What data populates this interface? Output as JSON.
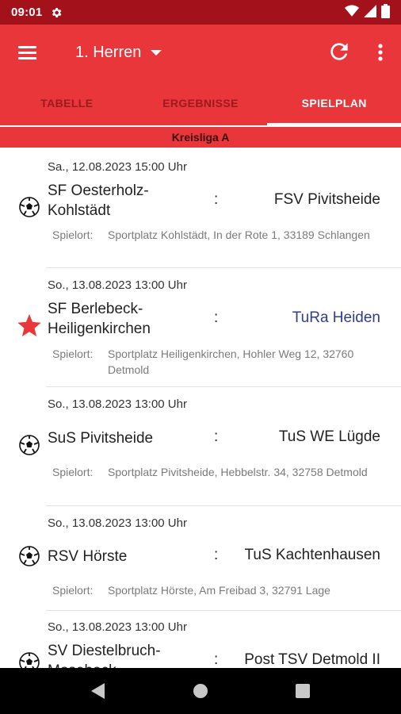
{
  "status_bar": {
    "time": "09:01"
  },
  "app_bar": {
    "team": "1. Herren",
    "tabs": [
      {
        "label": "TABELLE",
        "active": false
      },
      {
        "label": "ERGEBNISSE",
        "active": false
      },
      {
        "label": "SPIELPLAN",
        "active": true
      }
    ],
    "accent_color": "#e8363a",
    "status_color": "#a3121a"
  },
  "league": "Kreisliga A",
  "venue_label": "Spielort:",
  "matches": [
    {
      "date": "Sa., 12.08.2023  15:00 Uhr",
      "home": "SF Oesterholz-Kohlstädt",
      "sep": ":",
      "away": "FSV Pivitsheide",
      "venue": "Sportplatz Kohlstädt, In der Rote 1, 33189 Schlangen",
      "icon": "soccer-ball-icon"
    },
    {
      "date": "So., 13.08.2023  13:00 Uhr",
      "home": "SF Berlebeck-Heiligenkirchen",
      "sep": ":",
      "away": "TuRa Heiden",
      "venue": "Sportplatz Heiligenkirchen, Hohler Weg 12, 32760 Detmold",
      "icon": "star-icon",
      "favorite_color": "#2f3c8f"
    },
    {
      "date": "So., 13.08.2023  13:00 Uhr",
      "home": "SuS Pivitsheide",
      "sep": ":",
      "away": "TuS WE Lügde",
      "venue": "Sportplatz Pivitsheide, Hebbelstr. 34, 32758 Detmold",
      "icon": "soccer-ball-icon"
    },
    {
      "date": "So., 13.08.2023  13:00 Uhr",
      "home": "RSV Hörste",
      "sep": ":",
      "away": "TuS Kachtenhausen",
      "venue": "Sportplatz Hörste, Am Freibad 3, 32791 Lage",
      "icon": "soccer-ball-icon"
    },
    {
      "date": "So., 13.08.2023  13:00 Uhr",
      "home": "SV Diestelbruch-Mosebeck",
      "sep": ":",
      "away": "Post TSV Detmold II",
      "venue": "",
      "icon": "soccer-ball-icon"
    }
  ]
}
